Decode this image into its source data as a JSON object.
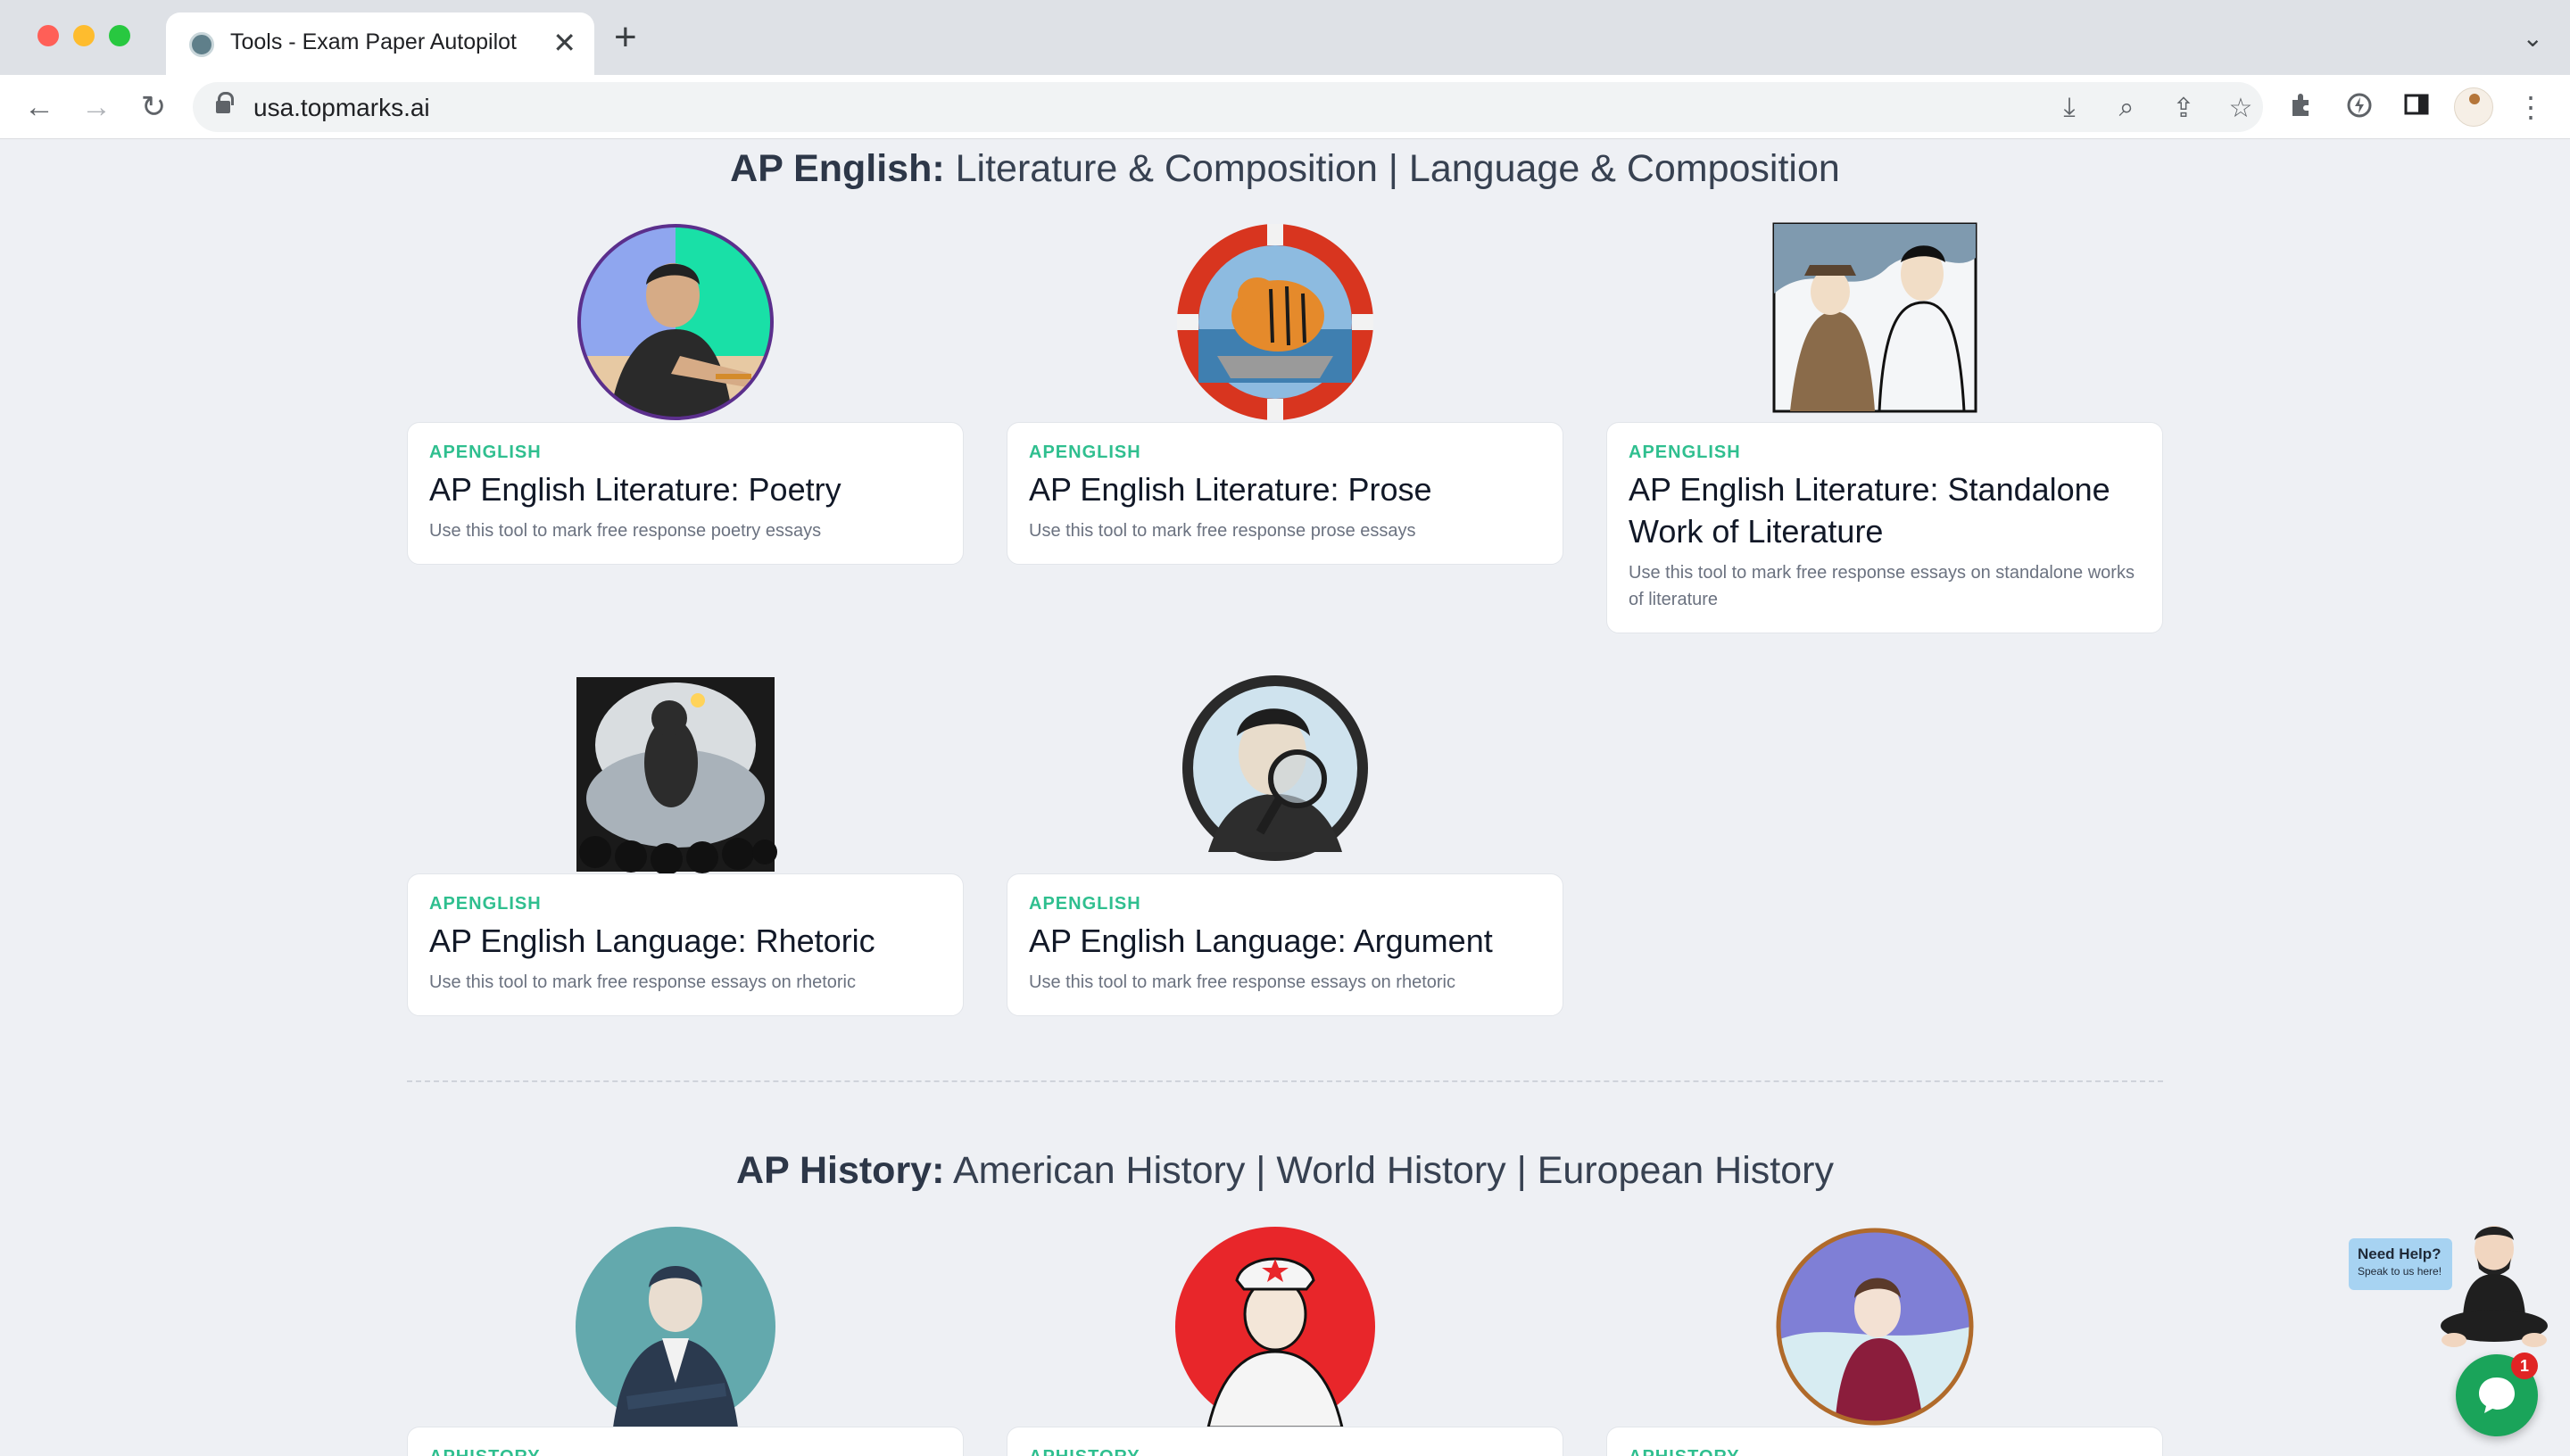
{
  "browser": {
    "tab_title": "Tools - Exam Paper Autopilot",
    "tab_close": "✕",
    "new_tab": "+",
    "url": "usa.topmarks.ai"
  },
  "sections": [
    {
      "heading_bold": "AP English:",
      "heading_rest": " Literature & Composition | Language & Composition",
      "cards": [
        {
          "category": "APENGLISH",
          "title": "AP English Literature: Poetry",
          "description": "Use this tool to mark free response poetry essays",
          "image": "man-writing-illustration"
        },
        {
          "category": "APENGLISH",
          "title": "AP English Literature: Prose",
          "description": "Use this tool to mark free response prose essays",
          "image": "tiger-in-lifeboat-illustration"
        },
        {
          "category": "APENGLISH",
          "title": "AP English Literature: Standalone Work of Literature",
          "description": "Use this tool to mark free response essays on standalone works of literature",
          "image": "two-travelers-illustration"
        },
        {
          "category": "APENGLISH",
          "title": "AP English Language: Rhetoric",
          "description": "Use this tool to mark free response essays on rhetoric",
          "image": "speaker-before-crowd-illustration"
        },
        {
          "category": "APENGLISH",
          "title": "AP English Language: Argument",
          "description": "Use this tool to mark free response essays on rhetoric",
          "image": "detective-magnifier-illustration"
        }
      ]
    },
    {
      "heading_bold": "AP History:",
      "heading_rest": " American History | World History | European History",
      "cards": [
        {
          "category": "APHISTORY",
          "image": "statesman-illustration"
        },
        {
          "category": "APHISTORY",
          "image": "soldier-illustration"
        },
        {
          "category": "APHISTORY",
          "image": "woman-in-red-coat-illustration"
        }
      ]
    }
  ],
  "help_widget": {
    "title": "Need Help?",
    "subtitle": "Speak to us here!",
    "badge": "1"
  },
  "colors": {
    "accent": "#2fbf8f",
    "chat_green": "#1aa45a",
    "badge_red": "#e02424"
  }
}
